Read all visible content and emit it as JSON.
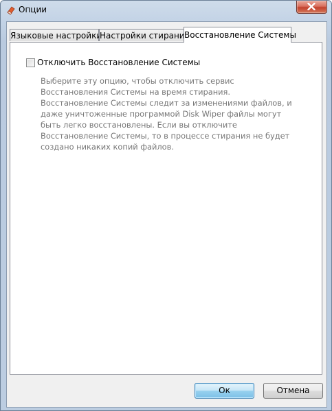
{
  "window": {
    "title": "Опции",
    "icon": "eraser-icon",
    "close_icon": "close-icon"
  },
  "tabs": [
    {
      "label": "Языковые настройки"
    },
    {
      "label": "Настройки стирания"
    },
    {
      "label": "Восстановление Системы",
      "active": true
    }
  ],
  "panel": {
    "checkbox_label": "Отключить Восстановление Системы",
    "checkbox_checked": false,
    "description": "Выберите эту опцию, чтобы отключить сервис Восстановления Системы на время стирания. Восстановление Системы следит за изменениями файлов, и даже уничтоженные программой Disk Wiper файлы могут быть легко восстановлены. Если вы отключите Восстановление Системы, то в процессе стирания не будет создано никаких копий файлов."
  },
  "buttons": {
    "ok": "Ок",
    "cancel": "Отмена"
  }
}
